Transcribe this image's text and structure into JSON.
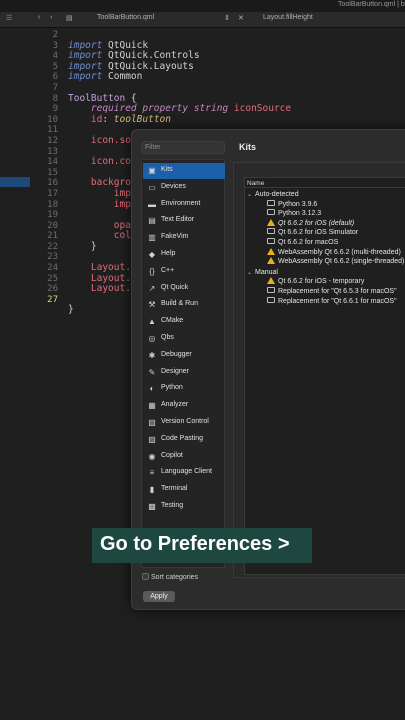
{
  "topbar": {
    "path": "ToolBarButton.qml | b"
  },
  "tabs": {
    "file": "ToolBarButton.qml",
    "symbol": "Layout.fillHeight"
  },
  "editor": {
    "line_numbers": [
      "2",
      "3",
      "4",
      "5",
      "6",
      "7",
      "8",
      "9",
      "10",
      "11",
      "12",
      "13",
      "14",
      "15",
      "16",
      "17",
      "18",
      "19",
      "20",
      "21",
      "22",
      "23",
      "24",
      "25",
      "26",
      "27"
    ],
    "code_lines": [
      [
        "import QtQuick"
      ],
      [
        "import QtQuick.Controls"
      ],
      [
        "import QtQuick.Layouts"
      ],
      [
        "import Common"
      ],
      [
        ""
      ],
      [
        "ToolButton {"
      ],
      [
        "    required property string iconSource"
      ],
      [
        "    id: toolButton"
      ],
      [
        ""
      ],
      [
        "    icon.sou"
      ],
      [
        ""
      ],
      [
        "    icon.co"
      ],
      [
        ""
      ],
      [
        "    backgro"
      ],
      [
        "        imp"
      ],
      [
        "        imp"
      ],
      [
        ""
      ],
      [
        "        opac"
      ],
      [
        "        colo"
      ],
      [
        "    }"
      ],
      [
        ""
      ],
      [
        "    Layout."
      ],
      [
        "    Layout.m"
      ],
      [
        "    Layout.m"
      ],
      [
        ""
      ],
      [
        "}"
      ]
    ]
  },
  "preferences": {
    "filter_placeholder": "Filter",
    "page_title": "Kits",
    "categories": [
      {
        "label": "Kits",
        "icon": "kits-icon",
        "selected": true
      },
      {
        "label": "Devices",
        "icon": "devices-icon"
      },
      {
        "label": "Environment",
        "icon": "environment-icon"
      },
      {
        "label": "Text Editor",
        "icon": "text-editor-icon"
      },
      {
        "label": "FakeVim",
        "icon": "fakevim-icon"
      },
      {
        "label": "Help",
        "icon": "help-icon"
      },
      {
        "label": "C++",
        "icon": "cpp-icon"
      },
      {
        "label": "Qt Quick",
        "icon": "qt-quick-icon"
      },
      {
        "label": "Build & Run",
        "icon": "build-run-icon"
      },
      {
        "label": "CMake",
        "icon": "cmake-icon"
      },
      {
        "label": "Qbs",
        "icon": "qbs-icon"
      },
      {
        "label": "Debugger",
        "icon": "debugger-icon"
      },
      {
        "label": "Designer",
        "icon": "designer-icon"
      },
      {
        "label": "Python",
        "icon": "python-icon"
      },
      {
        "label": "Analyzer",
        "icon": "analyzer-icon"
      },
      {
        "label": "Version Control",
        "icon": "version-control-icon"
      },
      {
        "label": "Code Pasting",
        "icon": "code-pasting-icon"
      },
      {
        "label": "Copilot",
        "icon": "copilot-icon"
      },
      {
        "label": "Language Client",
        "icon": "language-client-icon"
      },
      {
        "label": "Terminal",
        "icon": "terminal-icon"
      },
      {
        "label": "Testing",
        "icon": "testing-icon"
      }
    ],
    "sort_categories_label": "Sort categories",
    "apply_label": "Apply",
    "tree_header": "Name",
    "groups": {
      "auto_detected": "Auto-detected",
      "manual": "Manual"
    },
    "auto_kits": [
      {
        "label": "Python 3.9.6",
        "icon": "monitor-icon"
      },
      {
        "label": "Python 3.12.3",
        "icon": "monitor-icon"
      },
      {
        "label": "Qt 6.6.2 for iOS (default)",
        "icon": "warning-icon",
        "italic": true
      },
      {
        "label": "Qt 6.6.2 for iOS Simulator",
        "icon": "monitor-icon"
      },
      {
        "label": "Qt 6.6.2 for macOS",
        "icon": "monitor-icon"
      },
      {
        "label": "WebAssembly Qt 6.6.2 (multi-threaded)",
        "icon": "warning-icon"
      },
      {
        "label": "WebAssembly Qt 6.6.2 (single-threaded)",
        "icon": "warning-icon"
      }
    ],
    "manual_kits": [
      {
        "label": "Qt 6.6.2 for iOS - temporary",
        "icon": "warning-icon"
      },
      {
        "label": "Replacement for \"Qt 6.5.3 for macOS\"",
        "icon": "monitor-icon"
      },
      {
        "label": "Replacement for \"Qt 6.6.1 for macOS\"",
        "icon": "monitor-icon"
      }
    ]
  },
  "caption": {
    "text": "Go to Preferences >"
  }
}
